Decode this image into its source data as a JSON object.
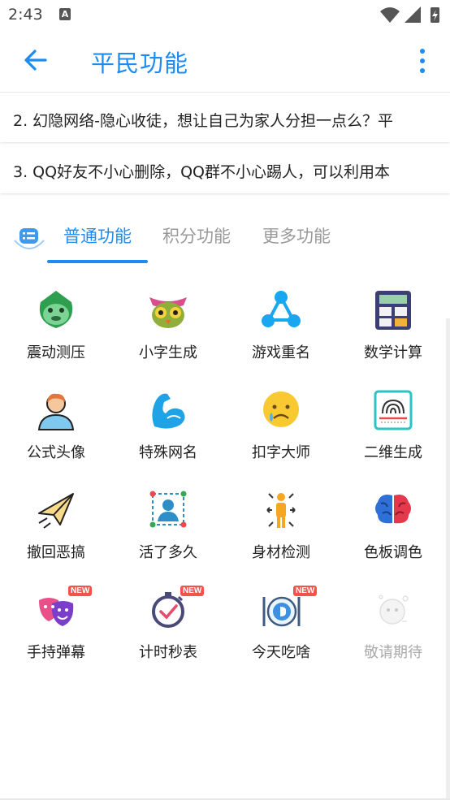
{
  "status_bar": {
    "time": "2:43",
    "badge": "A"
  },
  "app_bar": {
    "title": "平民功能",
    "back_icon": "arrow-left-icon",
    "more_icon": "more-vertical-icon"
  },
  "notices": [
    "2.  幻隐网络-隐心收徒，想让自己为家人分担一点么？平",
    "3.  QQ好友不小心删除，QQ群不小心踢人，可以利用本"
  ],
  "tabs": [
    {
      "label": "普通功能",
      "active": true
    },
    {
      "label": "积分功能",
      "active": false
    },
    {
      "label": "更多功能",
      "active": false
    }
  ],
  "grid": [
    {
      "label": "震动测压",
      "icon": "green-monster-icon"
    },
    {
      "label": "小字生成",
      "icon": "owl-face-icon"
    },
    {
      "label": "游戏重名",
      "icon": "share-nodes-icon"
    },
    {
      "label": "数学计算",
      "icon": "calculator-icon"
    },
    {
      "label": "公式头像",
      "icon": "person-avatar-icon"
    },
    {
      "label": "特殊网名",
      "icon": "muscle-arm-icon"
    },
    {
      "label": "扣字大师",
      "icon": "sad-face-icon"
    },
    {
      "label": "二维生成",
      "icon": "fingerprint-scan-icon"
    },
    {
      "label": "撤回恶搞",
      "icon": "paper-plane-icon"
    },
    {
      "label": "活了多久",
      "icon": "baby-scan-icon"
    },
    {
      "label": "身材检测",
      "icon": "body-measure-icon"
    },
    {
      "label": "色板调色",
      "icon": "brain-icon"
    },
    {
      "label": "手持弹幕",
      "icon": "theater-masks-icon",
      "badge": "NEW"
    },
    {
      "label": "计时秒表",
      "icon": "stopwatch-icon",
      "badge": "NEW"
    },
    {
      "label": "今天吃啥",
      "icon": "dinner-plate-icon",
      "badge": "NEW"
    },
    {
      "label": "敬请期待",
      "icon": "ghost-placeholder-icon",
      "muted": true
    }
  ],
  "colors": {
    "accent": "#1e8bf0",
    "badge": "#f2534b"
  }
}
